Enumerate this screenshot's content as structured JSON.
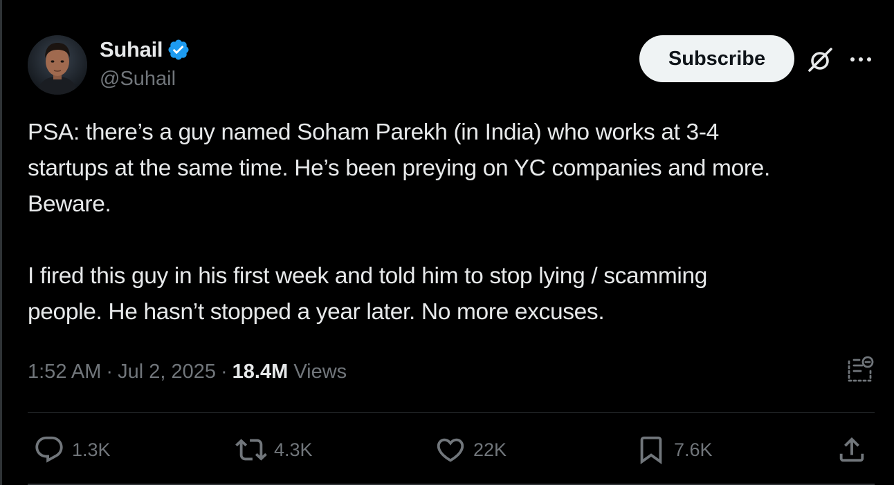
{
  "author": {
    "display_name": "Suhail",
    "handle": "@Suhail",
    "verified": true,
    "verified_color": "#1d9bf0"
  },
  "header": {
    "subscribe_label": "Subscribe",
    "grok_icon": "grok-icon",
    "more_icon": "more-horizontal-icon"
  },
  "tweet": {
    "text": "PSA: there’s a guy named Soham Parekh (in India) who works at 3-4\nstartups at the same time. He’s been preying on YC companies and more.\nBeware.\n\nI fired this guy in his first week and told him to stop lying / scamming\npeople. He hasn’t stopped a year later. No more excuses.",
    "time": "1:52 AM",
    "date": "Jul 2, 2025",
    "separator": "·",
    "views_count": "18.4M",
    "views_label": "Views"
  },
  "actions": {
    "replies": "1.3K",
    "reposts": "4.3K",
    "likes": "22K",
    "bookmarks": "7.6K"
  },
  "colors": {
    "background": "#000000",
    "primary_text": "#e7e9ea",
    "secondary_text": "#71767b",
    "divider": "#2f3336",
    "button_bg": "#eff3f4",
    "button_text": "#0f1419"
  }
}
